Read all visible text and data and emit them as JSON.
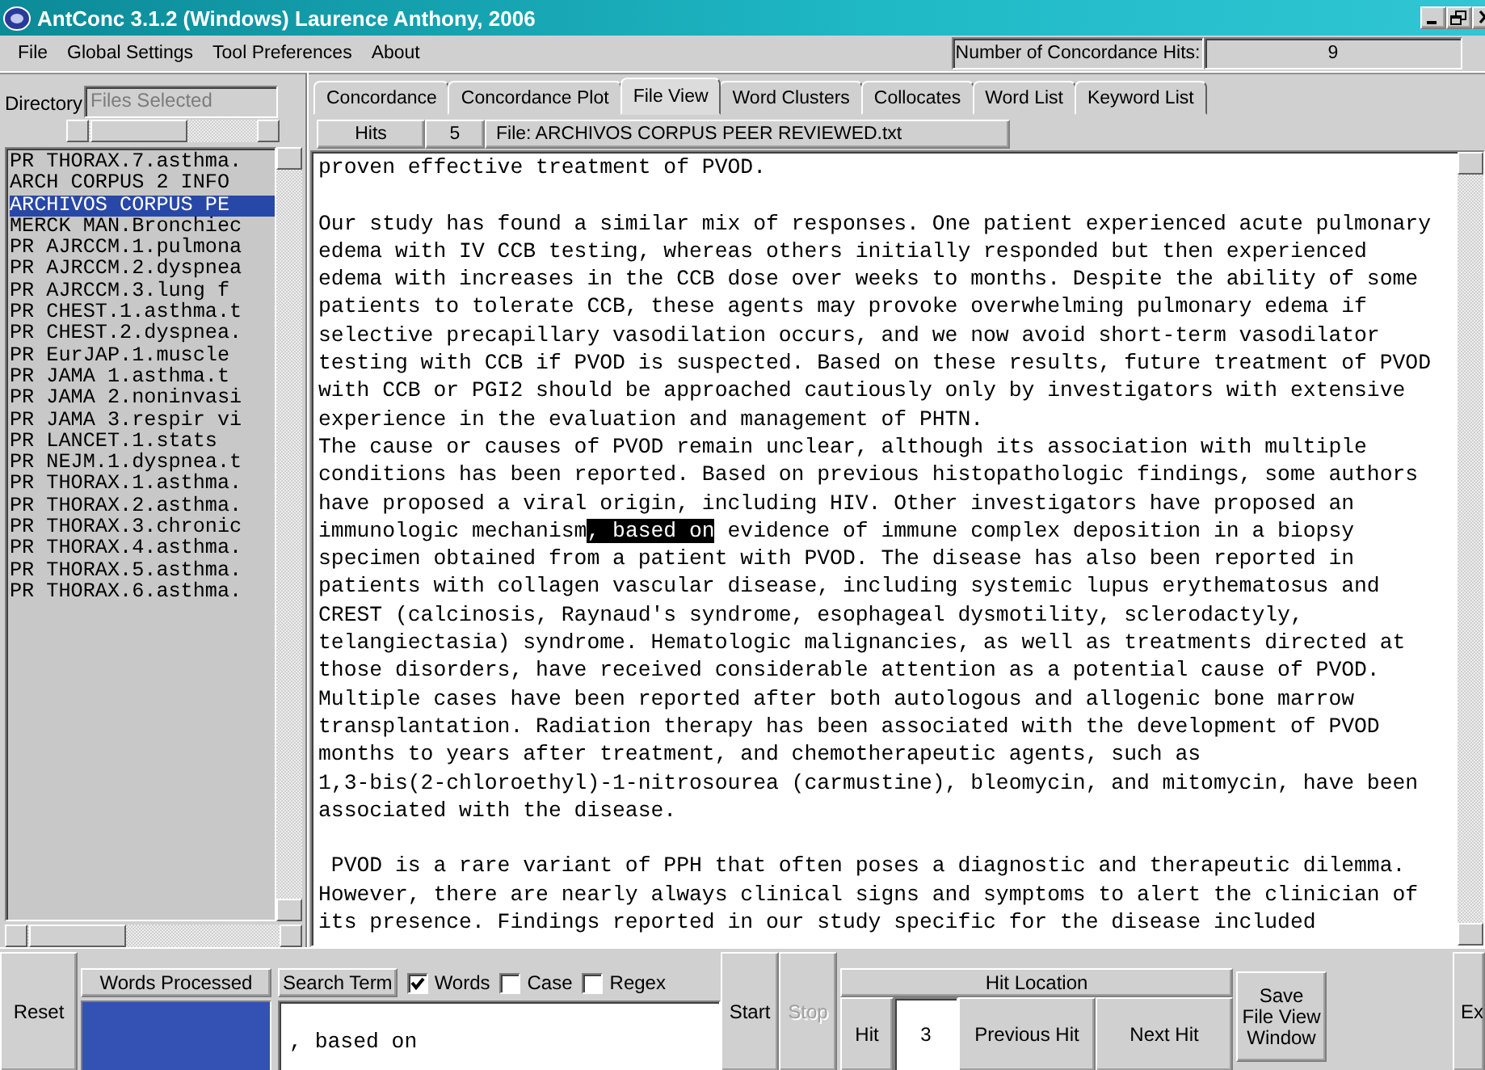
{
  "window": {
    "title": "AntConc 3.1.2 (Windows) Laurence Anthony, 2006"
  },
  "menu": [
    "File",
    "Global Settings",
    "Tool Preferences",
    "About"
  ],
  "hits_count": {
    "label": "Number of Concordance Hits:",
    "value": "9"
  },
  "directory": {
    "label": "Directory",
    "files_field": {
      "placeholder": "Files Selected"
    },
    "files": [
      {
        "name": "PR THORAX.7.asthma.",
        "selected": false
      },
      {
        "name": "ARCH CORPUS 2 INFO",
        "selected": false
      },
      {
        "name": "ARCHIVOS CORPUS PE",
        "selected": true
      },
      {
        "name": "MERCK MAN.Bronchiec",
        "selected": false
      },
      {
        "name": "PR AJRCCM.1.pulmona",
        "selected": false
      },
      {
        "name": "PR AJRCCM.2.dyspnea",
        "selected": false
      },
      {
        "name": "PR AJRCCM.3.lung f",
        "selected": false
      },
      {
        "name": "PR CHEST.1.asthma.t",
        "selected": false
      },
      {
        "name": "PR CHEST.2.dyspnea.",
        "selected": false
      },
      {
        "name": "PR EurJAP.1.muscle",
        "selected": false
      },
      {
        "name": "PR JAMA 1.asthma.t",
        "selected": false
      },
      {
        "name": "PR JAMA 2.noninvasi",
        "selected": false
      },
      {
        "name": "PR JAMA 3.respir vi",
        "selected": false
      },
      {
        "name": "PR LANCET.1.stats",
        "selected": false
      },
      {
        "name": "PR NEJM.1.dyspnea.t",
        "selected": false
      },
      {
        "name": "PR THORAX.1.asthma.",
        "selected": false
      },
      {
        "name": "PR THORAX.2.asthma.",
        "selected": false
      },
      {
        "name": "PR THORAX.3.chronic",
        "selected": false
      },
      {
        "name": "PR THORAX.4.asthma.",
        "selected": false
      },
      {
        "name": "PR THORAX.5.asthma.",
        "selected": false
      },
      {
        "name": "PR THORAX.6.asthma.",
        "selected": false
      }
    ]
  },
  "tabs": [
    {
      "label": "Concordance",
      "selected": false
    },
    {
      "label": "Concordance Plot",
      "selected": false
    },
    {
      "label": "File View",
      "selected": true
    },
    {
      "label": "Word Clusters",
      "selected": false
    },
    {
      "label": "Collocates",
      "selected": false
    },
    {
      "label": "Word List",
      "selected": false
    },
    {
      "label": "Keyword List",
      "selected": false
    }
  ],
  "file_view": {
    "hits_label": "Hits",
    "hits_value": "5",
    "file_label": "File: ARCHIVOS CORPUS PEER REVIEWED.txt",
    "paragraphs": [
      {
        "lines": [
          {
            "text": "proven effective treatment of PVOD."
          }
        ]
      },
      {
        "lines": [
          {
            "text": "Our study has found a similar mix of responses. One patient experienced acute pulmonary"
          },
          {
            "text": "edema with IV CCB testing, whereas others initially responded but then experienced"
          },
          {
            "text": "edema with increases in the CCB dose over weeks to months. Despite the ability of some"
          },
          {
            "text": "patients to tolerate CCB, these agents may provoke overwhelming pulmonary edema if"
          },
          {
            "text": "selective precapillary vasodilation occurs, and we now avoid short-term vasodilator"
          },
          {
            "text": "testing with CCB if PVOD is suspected. Based on these results, future treatment of PVOD"
          },
          {
            "text": "with CCB or PGI2 should be approached cautiously only by investigators with extensive"
          },
          {
            "text": "experience in the evaluation and management of PHTN."
          },
          {
            "text": "The cause or causes of PVOD remain unclear, although its association with multiple"
          },
          {
            "text": "conditions has been reported. Based on previous histopathologic findings, some authors"
          },
          {
            "text": "have proposed a viral origin, including HIV. Other investigators have proposed an"
          },
          {
            "text": "immunologic mechanism",
            "hit": ", based on",
            "after": " evidence of immune complex deposition in a biopsy"
          },
          {
            "text": "specimen obtained from a patient with PVOD. The disease has also been reported in"
          },
          {
            "text": "patients with collagen vascular disease, including systemic lupus erythematosus and"
          },
          {
            "text": "CREST (calcinosis, Raynaud's syndrome, esophageal dysmotility, sclerodactyly,"
          },
          {
            "text": "telangiectasia) syndrome. Hematologic malignancies, as well as treatments directed at"
          },
          {
            "text": "those disorders, have received considerable attention as a potential cause of PVOD."
          },
          {
            "text": "Multiple cases have been reported after both autologous and allogenic bone marrow"
          },
          {
            "text": "transplantation. Radiation therapy has been associated with the development of PVOD"
          },
          {
            "text": "months to years after treatment, and chemotherapeutic agents, such as"
          },
          {
            "text": "1,3-bis(2-chloroethyl)-1-nitrosourea (carmustine), bleomycin, and mitomycin, have been"
          },
          {
            "text": "associated with the disease."
          }
        ]
      },
      {
        "lines": [
          {
            "text": " PVOD is a rare variant of PPH that often poses a diagnostic and therapeutic dilemma."
          },
          {
            "text": "However, there are nearly always clinical signs and symptoms to alert the clinician of"
          },
          {
            "text": "its presence. Findings reported in our study specific for the disease included"
          }
        ]
      }
    ]
  },
  "controls": {
    "reset": "Reset",
    "words_processed": {
      "label": "Words Processed",
      "level": 1
    },
    "search_label": "Search Term",
    "options": [
      {
        "label": "Words",
        "checked": true
      },
      {
        "label": "Case",
        "checked": false
      },
      {
        "label": "Regex",
        "checked": false
      }
    ],
    "search_value": ", based on",
    "start": "Start",
    "stop": {
      "label": "Stop",
      "disabled": true
    },
    "hit_location": {
      "title": "Hit Location",
      "hit_label": "Hit",
      "hit_value": "3",
      "previous": "Previous Hit",
      "next": "Next Hit"
    },
    "save": "Save\nFile View\nWindow",
    "exit": "Ex"
  }
}
